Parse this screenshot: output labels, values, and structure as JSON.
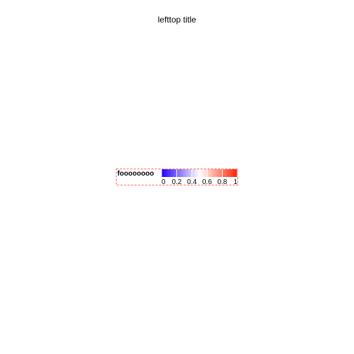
{
  "chart_data": {
    "type": "heatmap",
    "title": "lefttop title",
    "legend": {
      "label": "foooooooo",
      "ticks": [
        "0",
        "0.2",
        "0.4",
        "0.6",
        "0.8",
        "1"
      ],
      "tick_values": [
        0,
        0.2,
        0.4,
        0.6,
        0.8,
        1
      ],
      "range": [
        0,
        1
      ],
      "colors": [
        "#2200ff",
        "#ffffff",
        "#ff2200"
      ],
      "frame_color": "#ff6666",
      "placement": "center"
    }
  }
}
